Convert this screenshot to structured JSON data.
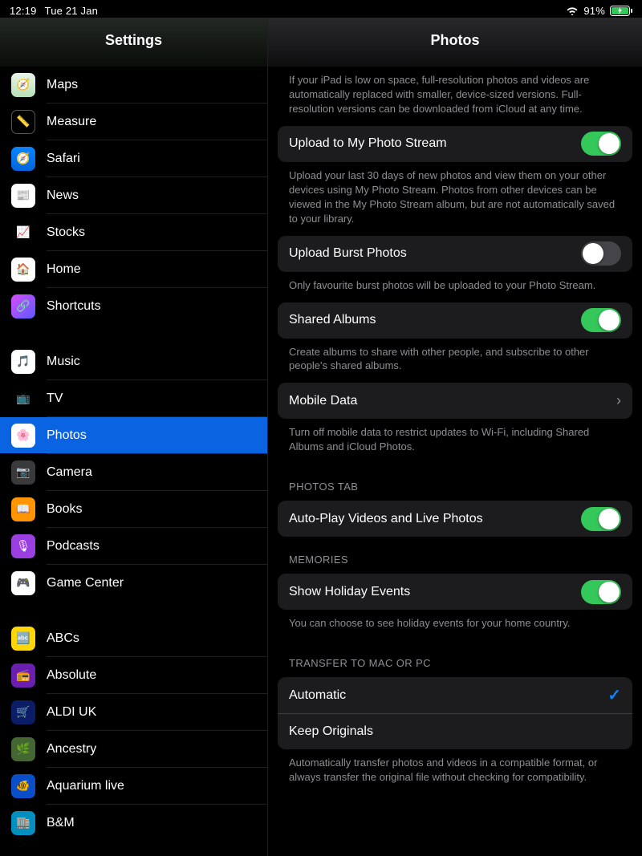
{
  "status": {
    "time": "12:19",
    "date": "Tue 21 Jan",
    "battery": "91%"
  },
  "sidebar": {
    "title": "Settings",
    "groups": [
      {
        "items": [
          {
            "id": "maps",
            "label": "Maps",
            "icon": "ic-maps",
            "glyph": "🧭"
          },
          {
            "id": "measure",
            "label": "Measure",
            "icon": "ic-measure",
            "glyph": "📏"
          },
          {
            "id": "safari",
            "label": "Safari",
            "icon": "ic-safari",
            "glyph": "🧭"
          },
          {
            "id": "news",
            "label": "News",
            "icon": "ic-news",
            "glyph": "📰"
          },
          {
            "id": "stocks",
            "label": "Stocks",
            "icon": "ic-stocks",
            "glyph": "📈"
          },
          {
            "id": "home",
            "label": "Home",
            "icon": "ic-home",
            "glyph": "🏠"
          },
          {
            "id": "shortcuts",
            "label": "Shortcuts",
            "icon": "ic-shortcuts",
            "glyph": "🔗"
          }
        ]
      },
      {
        "items": [
          {
            "id": "music",
            "label": "Music",
            "icon": "ic-music",
            "glyph": "🎵"
          },
          {
            "id": "tv",
            "label": "TV",
            "icon": "ic-tv",
            "glyph": "📺"
          },
          {
            "id": "photos",
            "label": "Photos",
            "icon": "ic-photos",
            "glyph": "🌸",
            "active": true
          },
          {
            "id": "camera",
            "label": "Camera",
            "icon": "ic-camera",
            "glyph": "📷"
          },
          {
            "id": "books",
            "label": "Books",
            "icon": "ic-books",
            "glyph": "📖"
          },
          {
            "id": "podcasts",
            "label": "Podcasts",
            "icon": "ic-podcasts",
            "glyph": "🎙"
          },
          {
            "id": "gamecenter",
            "label": "Game Center",
            "icon": "ic-gamecenter",
            "glyph": "🎮"
          }
        ]
      },
      {
        "items": [
          {
            "id": "abcs",
            "label": "ABCs",
            "icon": "ic-abcs",
            "glyph": "🔤"
          },
          {
            "id": "absolute",
            "label": "Absolute",
            "icon": "ic-absolute",
            "glyph": "📻"
          },
          {
            "id": "aldi",
            "label": "ALDI UK",
            "icon": "ic-aldi",
            "glyph": "🛒"
          },
          {
            "id": "ancestry",
            "label": "Ancestry",
            "icon": "ic-ancestry",
            "glyph": "🌿"
          },
          {
            "id": "aquarium",
            "label": "Aquarium live",
            "icon": "ic-aquarium",
            "glyph": "🐠"
          },
          {
            "id": "bm",
            "label": "B&M",
            "icon": "ic-bm",
            "glyph": "🏬"
          }
        ]
      }
    ]
  },
  "detail": {
    "title": "Photos",
    "intro": "If your iPad is low on space, full-resolution photos and videos are automatically replaced with smaller, device-sized versions. Full-resolution versions can be downloaded from iCloud at any time.",
    "uploadStream": {
      "label": "Upload to My Photo Stream",
      "on": true,
      "footer": "Upload your last 30 days of new photos and view them on your other devices using My Photo Stream. Photos from other devices can be viewed in the My Photo Stream album, but are not automatically saved to your library."
    },
    "burst": {
      "label": "Upload Burst Photos",
      "on": false,
      "footer": "Only favourite burst photos will be uploaded to your Photo Stream."
    },
    "shared": {
      "label": "Shared Albums",
      "on": true,
      "footer": "Create albums to share with other people, and subscribe to other people's shared albums."
    },
    "mobileData": {
      "label": "Mobile Data",
      "footer": "Turn off mobile data to restrict updates to Wi-Fi, including Shared Albums and iCloud Photos."
    },
    "photosTabHeader": "PHOTOS TAB",
    "autoplay": {
      "label": "Auto-Play Videos and Live Photos",
      "on": true
    },
    "memoriesHeader": "MEMORIES",
    "holiday": {
      "label": "Show Holiday Events",
      "on": true,
      "footer": "You can choose to see holiday events for your home country."
    },
    "transferHeader": "TRANSFER TO MAC OR PC",
    "transfer": {
      "automatic": "Automatic",
      "keep": "Keep Originals",
      "footer": "Automatically transfer photos and videos in a compatible format, or always transfer the original file without checking for compatibility."
    }
  }
}
